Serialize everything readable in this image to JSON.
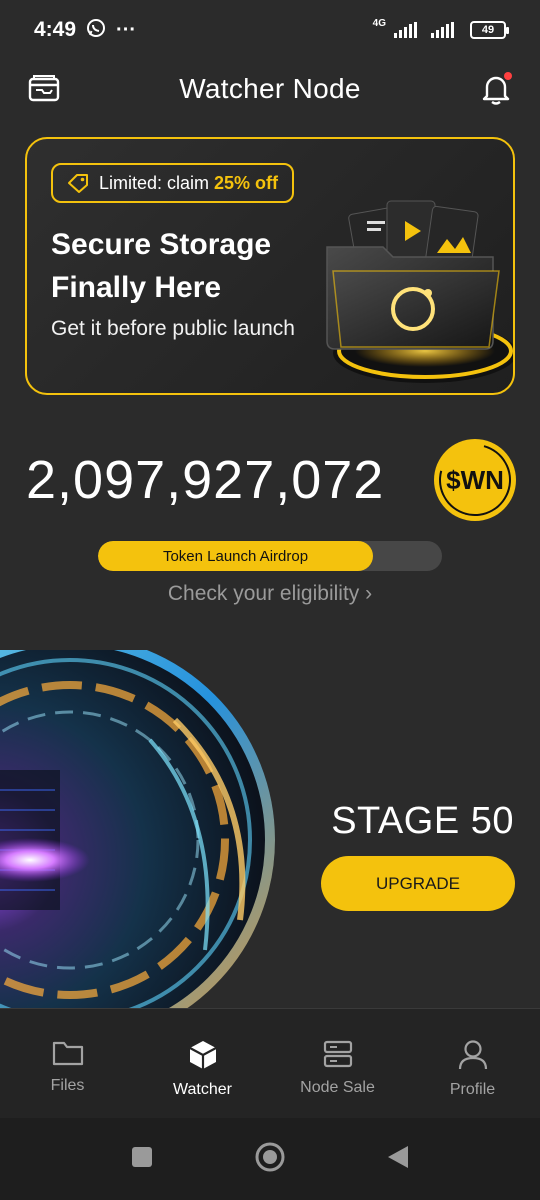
{
  "status_bar": {
    "time": "4:49",
    "network": "4G",
    "battery": "49"
  },
  "header": {
    "title": "Watcher Node"
  },
  "promo": {
    "badge_prefix": "Limited: claim ",
    "badge_highlight": "25% off",
    "title": "Secure Storage Finally Here",
    "subtitle": "Get it before public launch"
  },
  "balance": {
    "amount": "2,097,927,072",
    "token_symbol": "$WN"
  },
  "airdrop": {
    "label": "Token Launch Airdrop",
    "progress_fraction": 0.8,
    "eligibility_link": "Check your eligibility ›"
  },
  "stage": {
    "label": "STAGE 50",
    "upgrade_label": "UPGRADE"
  },
  "bottom_nav": {
    "items": [
      {
        "label": "Files",
        "icon": "folder-icon"
      },
      {
        "label": "Watcher",
        "icon": "cube-icon",
        "active": true
      },
      {
        "label": "Node Sale",
        "icon": "server-icon"
      },
      {
        "label": "Profile",
        "icon": "user-icon"
      }
    ]
  },
  "colors": {
    "accent": "#f4c20d",
    "background": "#2b2b2b",
    "nav_background": "#242424",
    "muted_text": "#9a9a9a"
  }
}
